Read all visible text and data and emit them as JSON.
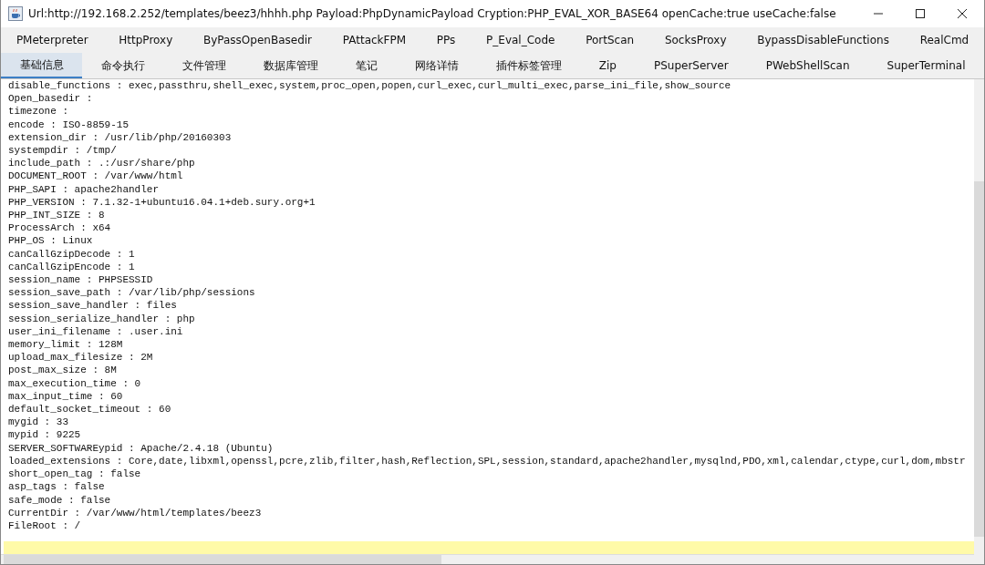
{
  "window": {
    "title": "Url:http://192.168.2.252/templates/beez3/hhhh.php Payload:PhpDynamicPayload Cryption:PHP_EVAL_XOR_BASE64 openCache:true useCache:false"
  },
  "tab_rows": [
    {
      "tabs": [
        {
          "label": "PMeterpreter",
          "selected": false
        },
        {
          "label": "HttpProxy",
          "selected": false
        },
        {
          "label": "ByPassOpenBasedir",
          "selected": false
        },
        {
          "label": "PAttackFPM",
          "selected": false
        },
        {
          "label": "PPs",
          "selected": false
        },
        {
          "label": "P_Eval_Code",
          "selected": false
        },
        {
          "label": "PortScan",
          "selected": false
        },
        {
          "label": "SocksProxy",
          "selected": false
        },
        {
          "label": "BypassDisableFunctions",
          "selected": false
        },
        {
          "label": "RealCmd",
          "selected": false
        }
      ]
    },
    {
      "tabs": [
        {
          "label": "基础信息",
          "selected": true
        },
        {
          "label": "命令执行",
          "selected": false
        },
        {
          "label": "文件管理",
          "selected": false
        },
        {
          "label": "数据库管理",
          "selected": false
        },
        {
          "label": "笔记",
          "selected": false
        },
        {
          "label": "网络详情",
          "selected": false
        },
        {
          "label": "插件标签管理",
          "selected": false
        },
        {
          "label": "Zip",
          "selected": false
        },
        {
          "label": "PSuperServer",
          "selected": false
        },
        {
          "label": "PWebShellScan",
          "selected": false
        },
        {
          "label": "SuperTerminal",
          "selected": false
        }
      ]
    }
  ],
  "info_lines": [
    "disable_functions : exec,passthru,shell_exec,system,proc_open,popen,curl_exec,curl_multi_exec,parse_ini_file,show_source",
    "Open_basedir :",
    "timezone :",
    "encode : ISO-8859-15",
    "extension_dir : /usr/lib/php/20160303",
    "systempdir : /tmp/",
    "include_path : .:/usr/share/php",
    "DOCUMENT_ROOT : /var/www/html",
    "PHP_SAPI : apache2handler",
    "PHP_VERSION : 7.1.32-1+ubuntu16.04.1+deb.sury.org+1",
    "PHP_INT_SIZE : 8",
    "ProcessArch : x64",
    "PHP_OS : Linux",
    "canCallGzipDecode : 1",
    "canCallGzipEncode : 1",
    "session_name : PHPSESSID",
    "session_save_path : /var/lib/php/sessions",
    "session_save_handler : files",
    "session_serialize_handler : php",
    "user_ini_filename : .user.ini",
    "memory_limit : 128M",
    "upload_max_filesize : 2M",
    "post_max_size : 8M",
    "max_execution_time : 0",
    "max_input_time : 60",
    "default_socket_timeout : 60",
    "mygid : 33",
    "mypid : 9225",
    "SERVER_SOFTWAREypid : Apache/2.4.18 (Ubuntu)",
    "loaded_extensions : Core,date,libxml,openssl,pcre,zlib,filter,hash,Reflection,SPL,session,standard,apache2handler,mysqlnd,PDO,xml,calendar,ctype,curl,dom,mbstr",
    "short_open_tag : false",
    "asp_tags : false",
    "safe_mode : false",
    "CurrentDir : /var/www/html/templates/beez3",
    "FileRoot : /"
  ]
}
